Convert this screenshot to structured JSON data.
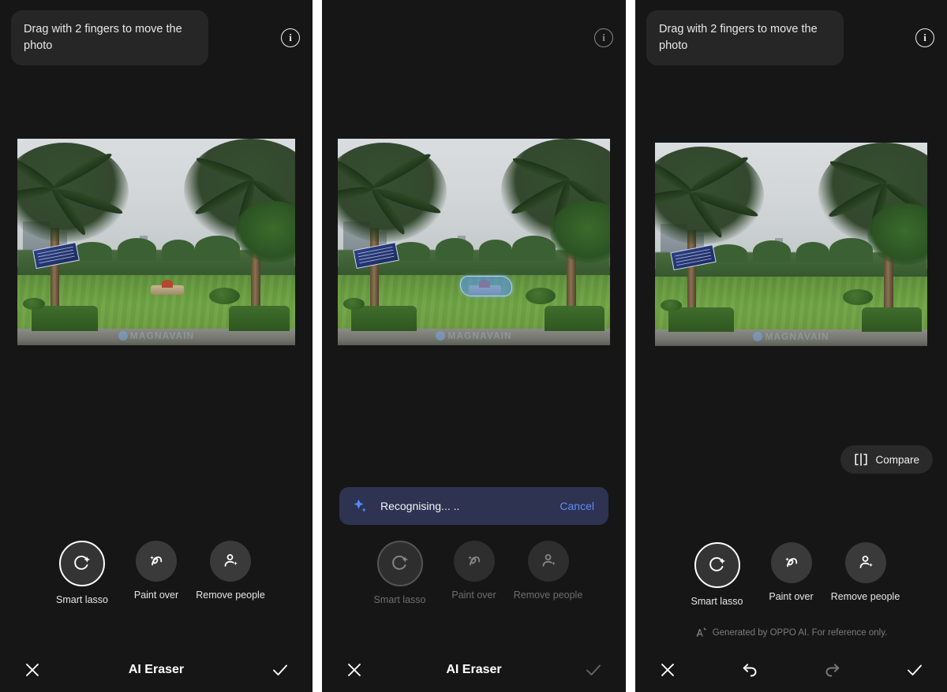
{
  "app": {
    "title": "AI Eraser",
    "background_color": "#161616",
    "accent_color": "#5c8dfc"
  },
  "tooltip": {
    "text": "Drag with 2 fingers to move the photo",
    "info_icon": "info-icon"
  },
  "tools": [
    {
      "label": "Smart lasso",
      "icon": "smart-lasso-icon",
      "selected": true
    },
    {
      "label": "Paint over",
      "icon": "paint-over-icon",
      "selected": false
    },
    {
      "label": "Remove people",
      "icon": "remove-people-icon",
      "selected": false
    }
  ],
  "panel1": {
    "state": "tool-selection",
    "bottom_bar": {
      "title": "AI Eraser",
      "close_icon": "close-icon",
      "confirm_icon": "check-icon"
    }
  },
  "panel2": {
    "state": "processing",
    "banner": {
      "icon": "sparkle-icon",
      "label": "Recognising... ..",
      "cancel_label": "Cancel",
      "background_color": "#2d3350",
      "cancel_color": "#5c8dfc"
    },
    "bottom_bar": {
      "title": "AI Eraser",
      "close_icon": "close-icon",
      "confirm_icon": "check-icon"
    }
  },
  "panel3": {
    "state": "result",
    "compare": {
      "label": "Compare",
      "icon": "compare-split-icon"
    },
    "disclaimer": {
      "icon": "ai-sparkle-icon",
      "text": "Generated by OPPO AI. For reference only."
    },
    "bottom_nav": {
      "close_icon": "close-icon",
      "undo_icon": "undo-icon",
      "redo_icon": "redo-icon",
      "confirm_icon": "check-icon",
      "redo_disabled": true
    }
  },
  "photo": {
    "description": "Park lawn with palm trees and overcast sky",
    "watermark": "MAGNAVAIN",
    "selection_overlay_color": "#5c96e6"
  }
}
